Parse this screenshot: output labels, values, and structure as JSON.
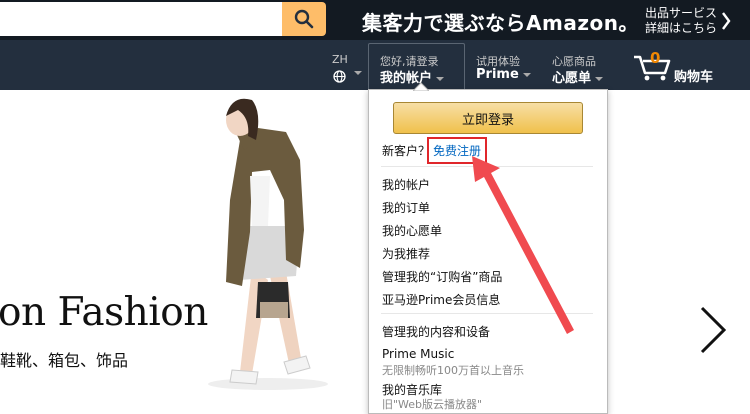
{
  "search": {
    "value": "",
    "placeholder": ""
  },
  "promo": {
    "main": "集客力で選ぶならAmazon。",
    "side_line1": "出品サービス",
    "side_line2": "詳細はこちら"
  },
  "nav": {
    "language": {
      "code": "ZH"
    },
    "account": {
      "greeting": "您好,请登录",
      "label": "我的帐户"
    },
    "prime": {
      "small": "试用体验",
      "label": "Prime"
    },
    "wishlist": {
      "small": "心愿商品",
      "label": "心愿单"
    },
    "cart": {
      "count": "0",
      "label": "购物车"
    }
  },
  "hero": {
    "title": "on Fashion",
    "subtitle": "鞋靴、箱包、饰品"
  },
  "dropdown": {
    "signin_label": "立即登录",
    "new_customer": "新客户？",
    "register_label": "免费注册",
    "items": [
      {
        "label": "我的帐户"
      },
      {
        "label": "我的订单"
      },
      {
        "label": "我的心愿单"
      },
      {
        "label": "为我推荐"
      },
      {
        "label": "管理我的“订购省”商品"
      },
      {
        "label": "亚马逊Prime会员信息"
      }
    ],
    "items2": [
      {
        "label": "管理我的内容和设备"
      },
      {
        "label": "Prime Music",
        "sub": "无限制畅听100万首以上音乐"
      },
      {
        "label": "我的音乐库",
        "sub": "旧\"Web版云播放器\""
      }
    ]
  },
  "colors": {
    "nav_top": "#131a22",
    "nav_bottom": "#232f3e",
    "search_button": "#febd69",
    "cart_count": "#f08804",
    "highlight_box": "#e0262b",
    "arrow": "#f04a4f",
    "link": "#0066c0"
  }
}
